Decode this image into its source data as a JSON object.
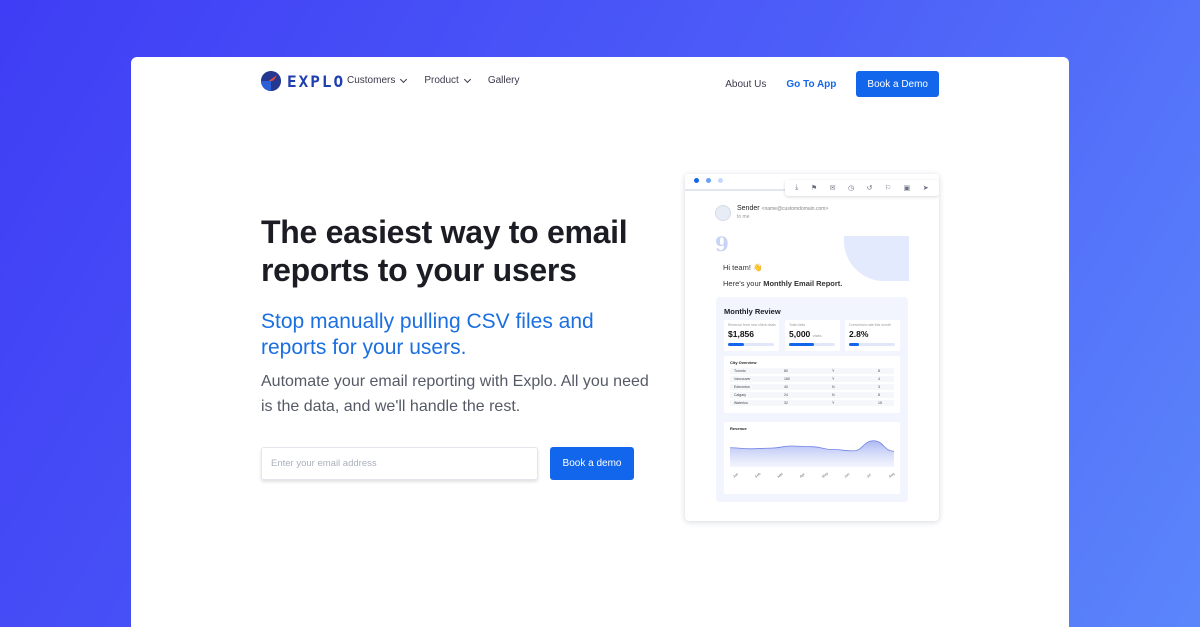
{
  "brand": {
    "name": "EXPLO"
  },
  "nav": {
    "menu": [
      {
        "label": "Customers",
        "dropdown": true
      },
      {
        "label": "Product",
        "dropdown": true
      },
      {
        "label": "Gallery",
        "dropdown": false
      }
    ],
    "about": "About Us",
    "go_to_app": "Go To App",
    "book_demo": "Book a Demo"
  },
  "hero": {
    "title": "The easiest way to email reports to your users",
    "subtitle": "Stop manually pulling CSV files and reports for your users.",
    "description": "Automate your email reporting with Explo. All you need is the data, and we'll handle the rest.",
    "email_placeholder": "Enter your email address",
    "cta": "Book a demo"
  },
  "colors": {
    "accent": "#1266ec",
    "background_gradient": [
      "#3f3df5",
      "#5b86fb"
    ]
  },
  "preview": {
    "window_dots": [
      "#1266ec",
      "#6aa0f5",
      "#c6d8fb"
    ],
    "toolbar_icons": [
      "download-icon",
      "flag-icon",
      "mail-icon",
      "clock-icon",
      "history-icon",
      "flag-icon",
      "image-icon",
      "send-icon"
    ],
    "sender": {
      "name": "Sender",
      "email": "<name@customdomain.com>",
      "to": "to me"
    },
    "greeting": "Hi team! 👋",
    "intro": "Here's your ",
    "intro_bold": "Monthly Email Report.",
    "report": {
      "title": "Monthly Review",
      "kpis": [
        {
          "label": "Revenue from new client deals",
          "value": "$1,856",
          "unit": "",
          "progress": 0.35
        },
        {
          "label": "Total visits",
          "value": "5,000",
          "unit": "visits",
          "progress": 0.55
        },
        {
          "label": "Conversion rate this month",
          "value": "2.8%",
          "unit": "",
          "progress": 0.22
        }
      ],
      "city_overview": {
        "title": "City Overview",
        "rows": [
          [
            "Toronto",
            "80",
            "Y",
            "8"
          ],
          [
            "Vancouver",
            "160",
            "Y",
            "4"
          ],
          [
            "Edmonton",
            "40",
            "N",
            "3"
          ],
          [
            "Calgary",
            "24",
            "N",
            "8"
          ],
          [
            "Waterloo",
            "32",
            "Y",
            "15"
          ]
        ]
      },
      "revenue": {
        "title": "Revenue"
      }
    }
  },
  "chart_data": {
    "type": "area",
    "title": "Revenue",
    "x": [
      "Jan",
      "Feb",
      "Mar",
      "Apr",
      "May",
      "Jun",
      "Jul",
      "Aug"
    ],
    "series": [
      {
        "values": [
          55,
          52,
          54,
          60,
          58,
          50,
          46,
          75,
          45
        ]
      }
    ],
    "ylim": [
      0,
      100
    ],
    "grid": false
  }
}
